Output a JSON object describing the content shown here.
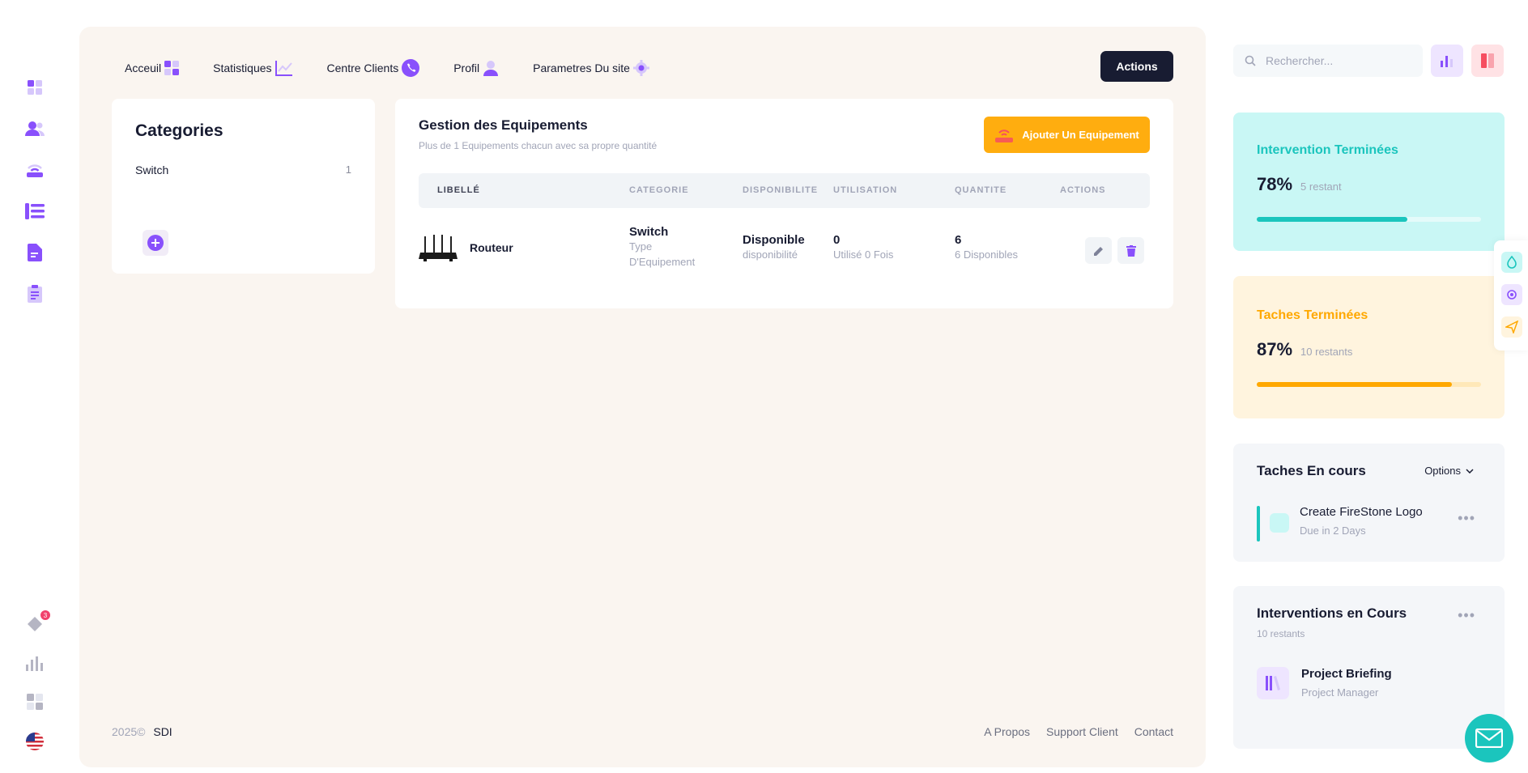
{
  "nav": {
    "items": [
      {
        "label": "Acceuil",
        "icon": "dashboard-icon"
      },
      {
        "label": "Statistiques",
        "icon": "chart-line-icon"
      },
      {
        "label": "Centre Clients",
        "icon": "phone-icon"
      },
      {
        "label": "Profil",
        "icon": "user-icon"
      },
      {
        "label": "Parametres Du site",
        "icon": "gear-icon"
      }
    ],
    "actions_label": "Actions"
  },
  "rail": {
    "badge_count": "3"
  },
  "categories": {
    "title": "Categories",
    "items": [
      {
        "name": "Switch",
        "count": "1"
      }
    ]
  },
  "equipment": {
    "title": "Gestion des Equipements",
    "subtitle": "Plus de 1 Equipements chacun avec sa propre quantité",
    "add_label": "Ajouter Un Equipement",
    "columns": [
      "LIBELLÉ",
      "CATEGORIE",
      "DISPONIBILITE",
      "UTILISATION",
      "QUANTITE",
      "ACTIONS"
    ],
    "rows": [
      {
        "name": "Routeur",
        "category": "Switch",
        "category_sub": "Type D'Equipement",
        "availability": "Disponible",
        "availability_sub": "disponibilité",
        "usage": "0",
        "usage_sub": "Utilisé 0 Fois",
        "quantity": "6",
        "quantity_sub": "6 Disponibles"
      }
    ]
  },
  "footer": {
    "year": "2025©",
    "brand": "SDI",
    "links": [
      "A Propos",
      "Support Client",
      "Contact"
    ]
  },
  "search": {
    "placeholder": "Rechercher..."
  },
  "stats": [
    {
      "title": "Intervention Terminées",
      "percent": "78%",
      "remaining": "5 restant",
      "progress": 0.67,
      "color": "#1bc5bd",
      "bg": "#c9f7f5"
    },
    {
      "title": "Taches Terminées",
      "percent": "87%",
      "remaining": "10 restants",
      "progress": 0.87,
      "color": "#ffa800",
      "bg": "#fff4de"
    }
  ],
  "tasks": {
    "title": "Taches En cours",
    "options_label": "Options",
    "items": [
      {
        "title": "Create FireStone Logo",
        "due": "Due in 2 Days"
      }
    ]
  },
  "interventions": {
    "title": "Interventions en Cours",
    "count": "10 restants",
    "items": [
      {
        "title": "Project Briefing",
        "role": "Project Manager"
      }
    ]
  }
}
